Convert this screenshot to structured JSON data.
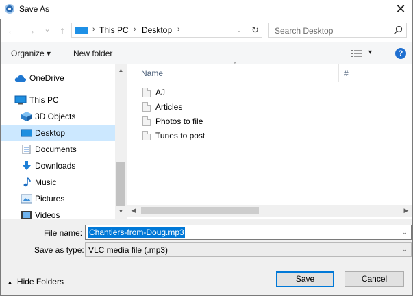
{
  "window": {
    "title": "Save As",
    "close_glyph": "✕"
  },
  "nav": {
    "back": "←",
    "forward": "→",
    "recent": "⌄",
    "up": "↑",
    "address": {
      "segments": [
        "This PC",
        "Desktop"
      ],
      "sep": "›",
      "dropdown": "⌄",
      "refresh": "↻"
    },
    "search": {
      "placeholder": "Search Desktop"
    }
  },
  "toolbar": {
    "organize": "Organize ▾",
    "new_folder": "New folder",
    "view_caret": "▾",
    "help": "?"
  },
  "sidebar": {
    "items": [
      {
        "label": "OneDrive",
        "icon": "cloud-icon",
        "level": 0,
        "selected": false
      },
      {
        "label": "This PC",
        "icon": "computer-icon",
        "level": 0,
        "selected": false
      },
      {
        "label": "3D Objects",
        "icon": "cube-icon",
        "level": 1,
        "selected": false
      },
      {
        "label": "Desktop",
        "icon": "desktop-icon",
        "level": 1,
        "selected": true
      },
      {
        "label": "Documents",
        "icon": "documents-icon",
        "level": 1,
        "selected": false
      },
      {
        "label": "Downloads",
        "icon": "download-icon",
        "level": 1,
        "selected": false
      },
      {
        "label": "Music",
        "icon": "music-icon",
        "level": 1,
        "selected": false
      },
      {
        "label": "Pictures",
        "icon": "pictures-icon",
        "level": 1,
        "selected": false
      },
      {
        "label": "Videos",
        "icon": "video-icon",
        "level": 1,
        "selected": false
      }
    ],
    "scroll_up": "▲",
    "scroll_down": "▼"
  },
  "files": {
    "columns": [
      "Name",
      "#"
    ],
    "sort_glyph": "^",
    "items": [
      "AJ",
      "Articles",
      "Photos to file",
      "Tunes to post"
    ],
    "scroll_left": "◀",
    "scroll_right": "▶"
  },
  "form": {
    "filename_label": "File name:",
    "filename_value": "Chantiers-from-Doug.mp3",
    "savetype_label": "Save as type:",
    "savetype_value": "VLC media file (.mp3)",
    "combo_arrow": "⌄",
    "hide_folders": "Hide Folders",
    "hide_caret": "▲",
    "save": "Save",
    "cancel": "Cancel"
  },
  "colors": {
    "selection": "#cce8ff",
    "accent": "#0078d7"
  }
}
